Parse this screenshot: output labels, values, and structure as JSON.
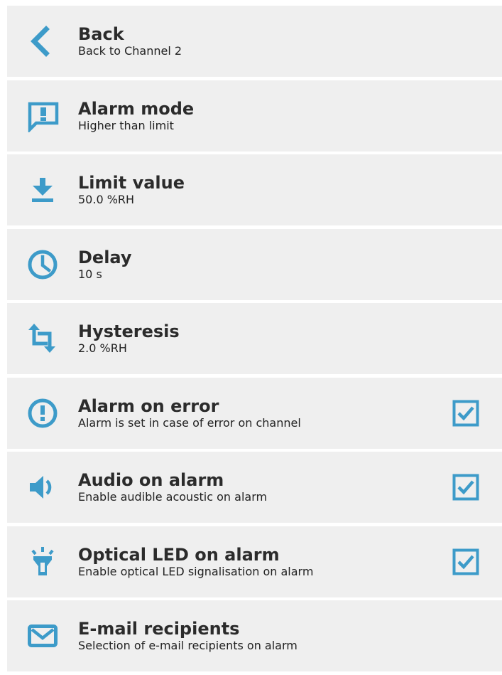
{
  "colors": {
    "accent": "#3d9bc9",
    "item_background": "#efefef",
    "text": "#2b2b2b"
  },
  "items": [
    {
      "title": "Back",
      "subtitle": "Back to Channel 2",
      "icon": "chevron-left-icon"
    },
    {
      "title": "Alarm mode",
      "subtitle": "Higher than limit",
      "icon": "alert-bubble-icon"
    },
    {
      "title": "Limit value",
      "subtitle": "50.0 %RH",
      "icon": "download-arrow-icon"
    },
    {
      "title": "Delay",
      "subtitle": "10 s",
      "icon": "clock-icon"
    },
    {
      "title": "Hysteresis",
      "subtitle": "2.0 %RH",
      "icon": "crop-arrows-icon"
    },
    {
      "title": "Alarm on error",
      "subtitle": "Alarm is set in case of error on channel",
      "icon": "exclamation-circle-icon",
      "checked": true
    },
    {
      "title": "Audio on alarm",
      "subtitle": "Enable audible acoustic on alarm",
      "icon": "speaker-icon",
      "checked": true
    },
    {
      "title": "Optical LED on alarm",
      "subtitle": "Enable optical LED signalisation on alarm",
      "icon": "led-light-icon",
      "checked": true
    },
    {
      "title": "E-mail recipients",
      "subtitle": "Selection of e-mail recipients on alarm",
      "icon": "envelope-icon"
    }
  ]
}
